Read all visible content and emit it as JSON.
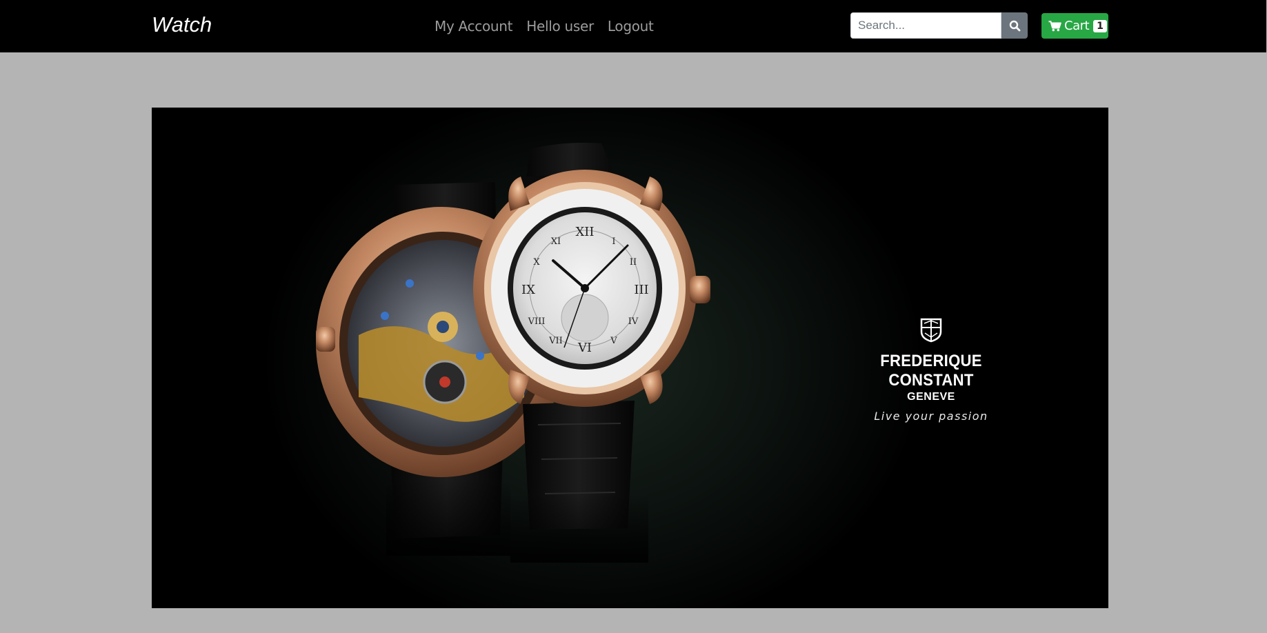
{
  "navbar": {
    "brand": "Watch",
    "links": [
      {
        "label": "My Account"
      },
      {
        "label": "Hello user"
      },
      {
        "label": "Logout"
      }
    ],
    "search": {
      "placeholder": "Search...",
      "value": ""
    },
    "cart": {
      "label": "Cart",
      "count": "1"
    }
  },
  "banner": {
    "brand_name": "FREDERIQUE CONSTANT",
    "brand_city": "GENEVE",
    "tagline": "Live your passion",
    "colors": {
      "bezel": "#c9926c",
      "strap": "#111111",
      "dial": "#e6e6e6"
    }
  },
  "colors": {
    "navbar_bg": "#000000",
    "page_bg": "#b4b4b4",
    "cart_button": "#28a745",
    "search_button": "#6c757d"
  }
}
